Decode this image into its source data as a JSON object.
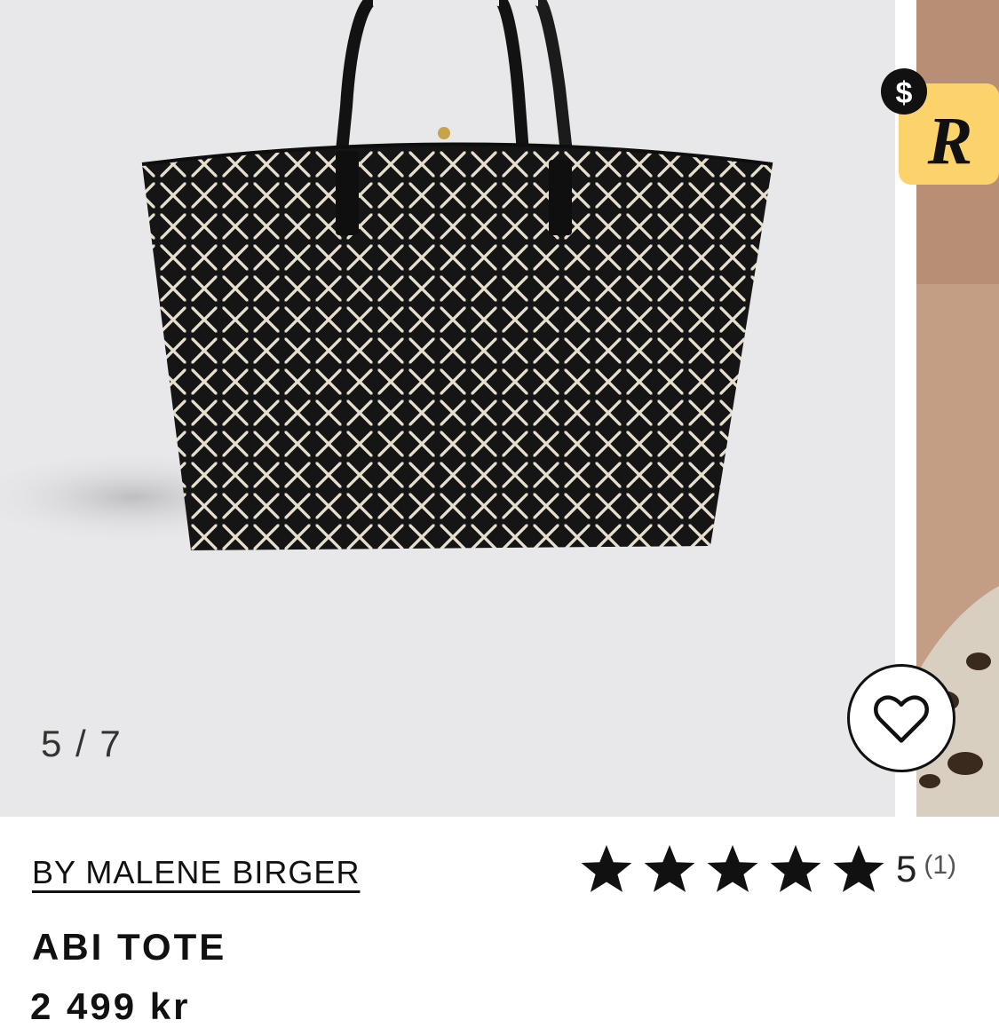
{
  "gallery": {
    "counter": "5 / 7",
    "favorite_label": "Add to favorites"
  },
  "badge": {
    "dollar_symbol": "$",
    "r_letter": "R"
  },
  "product": {
    "brand": "BY MALENE BIRGER",
    "title": "ABI TOTE",
    "price": "2 499 kr"
  },
  "rating": {
    "value": "5",
    "count": "(1)",
    "stars_filled": 5,
    "stars_total": 5
  },
  "colors": {
    "gallery_bg": "#e8e8ea",
    "badge_yellow": "#fcd26a",
    "text_dark": "#111111"
  }
}
